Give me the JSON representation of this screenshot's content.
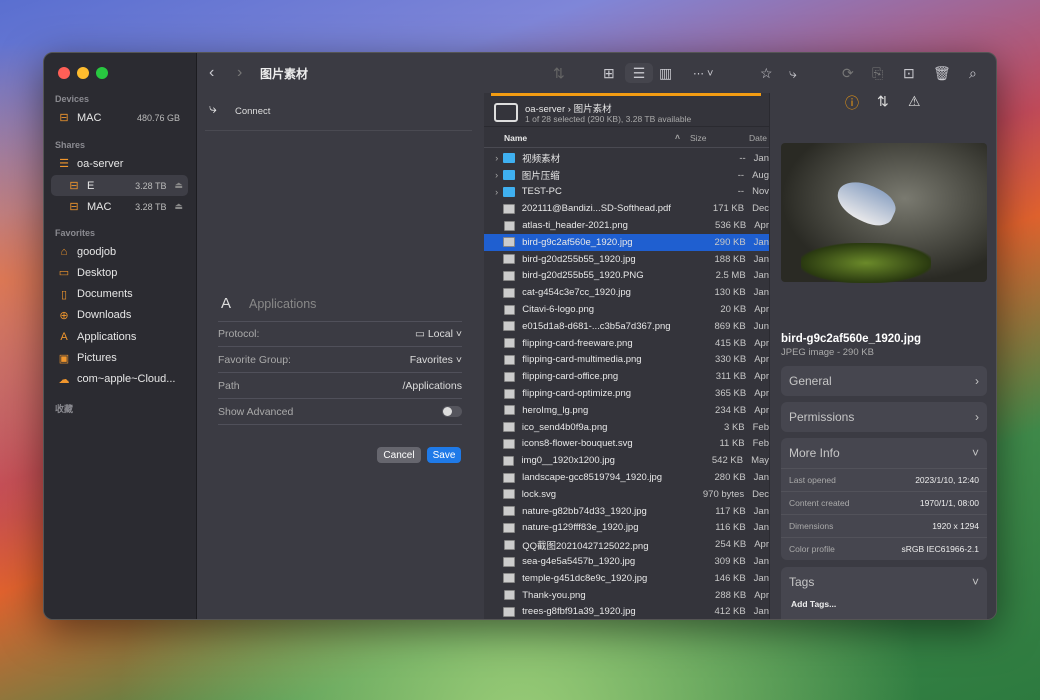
{
  "window": {
    "title": "图片素材"
  },
  "sidebar": {
    "sections": {
      "devices": "Devices",
      "shares": "Shares",
      "favorites": "Favorites",
      "collection": "收藏"
    },
    "devices": [
      {
        "label": "MAC",
        "size": "480.76 GB",
        "icon": "drive-icon"
      }
    ],
    "shares": [
      {
        "label": "oa-server",
        "icon": "server-icon"
      },
      {
        "label": "E",
        "size": "3.28 TB",
        "icon": "drive-icon",
        "eject": "⏏"
      },
      {
        "label": "MAC",
        "size": "3.28 TB",
        "icon": "drive-icon",
        "eject": "⏏"
      }
    ],
    "favorites": [
      {
        "label": "goodjob",
        "icon": "home-icon",
        "glyph": "⌂"
      },
      {
        "label": "Desktop",
        "icon": "desktop-icon",
        "glyph": "▭"
      },
      {
        "label": "Documents",
        "icon": "document-icon",
        "glyph": "▯"
      },
      {
        "label": "Downloads",
        "icon": "download-icon",
        "glyph": "⊕"
      },
      {
        "label": "Applications",
        "icon": "applications-icon",
        "glyph": "A"
      },
      {
        "label": "Pictures",
        "icon": "pictures-icon",
        "glyph": "▣"
      },
      {
        "label": "com~apple~Cloud...",
        "icon": "cloud-icon",
        "glyph": "☁"
      }
    ]
  },
  "connect": {
    "label": "Connect"
  },
  "form": {
    "title": "Applications",
    "protocol_label": "Protocol:",
    "protocol_value": "Local",
    "group_label": "Favorite Group:",
    "group_value": "Favorites",
    "path_label": "Path",
    "path_value": "/Applications",
    "advanced_label": "Show Advanced",
    "advanced_on": false,
    "cancel": "Cancel",
    "save": "Save"
  },
  "accent": "#f39c12",
  "selection_color": "#1f5fd0",
  "location": {
    "server": "oa-server",
    "folder": "图片素材",
    "status": "1 of 28 selected (290 KB), 3.28 TB available",
    "progress": 1.0
  },
  "columns": {
    "name": "Name",
    "size": "Size",
    "date": "Date"
  },
  "files": [
    {
      "name": "视频素材",
      "size": "--",
      "date": "Jan",
      "folder": true
    },
    {
      "name": "图片压缩",
      "size": "--",
      "date": "Aug",
      "folder": true
    },
    {
      "name": "TEST-PC",
      "size": "--",
      "date": "Nov",
      "folder": true
    },
    {
      "name": "202111@Bandizi...SD-Softhead.pdf",
      "size": "171 KB",
      "date": "Dec"
    },
    {
      "name": "atlas-ti_header-2021.png",
      "size": "536 KB",
      "date": "Apr"
    },
    {
      "name": "bird-g9c2af560e_1920.jpg",
      "size": "290 KB",
      "date": "Jan",
      "selected": true
    },
    {
      "name": "bird-g20d255b55_1920.jpg",
      "size": "188 KB",
      "date": "Jan"
    },
    {
      "name": "bird-g20d255b55_1920.PNG",
      "size": "2.5 MB",
      "date": "Jan"
    },
    {
      "name": "cat-g454c3e7cc_1920.jpg",
      "size": "130 KB",
      "date": "Jan"
    },
    {
      "name": "Citavi-6-logo.png",
      "size": "20 KB",
      "date": "Apr"
    },
    {
      "name": "e015d1a8-d681-...c3b5a7d367.png",
      "size": "869 KB",
      "date": "Jun"
    },
    {
      "name": "flipping-card-freeware.png",
      "size": "415 KB",
      "date": "Apr"
    },
    {
      "name": "flipping-card-multimedia.png",
      "size": "330 KB",
      "date": "Apr"
    },
    {
      "name": "flipping-card-office.png",
      "size": "311 KB",
      "date": "Apr"
    },
    {
      "name": "flipping-card-optimize.png",
      "size": "365 KB",
      "date": "Apr"
    },
    {
      "name": "heroImg_lg.png",
      "size": "234 KB",
      "date": "Apr"
    },
    {
      "name": "ico_send4b0f9a.png",
      "size": "3 KB",
      "date": "Feb"
    },
    {
      "name": "icons8-flower-bouquet.svg",
      "size": "11 KB",
      "date": "Feb"
    },
    {
      "name": "img0__1920x1200.jpg",
      "size": "542 KB",
      "date": "May"
    },
    {
      "name": "landscape-gcc8519794_1920.jpg",
      "size": "280 KB",
      "date": "Jan"
    },
    {
      "name": "lock.svg",
      "size": "970 bytes",
      "date": "Dec"
    },
    {
      "name": "nature-g82bb74d33_1920.jpg",
      "size": "117 KB",
      "date": "Jan"
    },
    {
      "name": "nature-g129fff83e_1920.jpg",
      "size": "116 KB",
      "date": "Jan"
    },
    {
      "name": "QQ截图20210427125022.png",
      "size": "254 KB",
      "date": "Apr"
    },
    {
      "name": "sea-g4e5a5457b_1920.jpg",
      "size": "309 KB",
      "date": "Jan"
    },
    {
      "name": "temple-g451dc8e9c_1920.jpg",
      "size": "146 KB",
      "date": "Jan"
    },
    {
      "name": "Thank-you.png",
      "size": "288 KB",
      "date": "Apr"
    },
    {
      "name": "trees-g8fbf91a39_1920.jpg",
      "size": "412 KB",
      "date": "Jan"
    }
  ],
  "info": {
    "filename": "bird-g9c2af560e_1920.jpg",
    "kind": "JPEG image - 290 KB",
    "general": "General",
    "permissions": "Permissions",
    "more_info": "More Info",
    "details": [
      {
        "k": "Last opened",
        "v": "2023/1/10, 12:40"
      },
      {
        "k": "Content created",
        "v": "1970/1/1, 08:00"
      },
      {
        "k": "Dimensions",
        "v": "1920 x 1294"
      },
      {
        "k": "Color profile",
        "v": "sRGB IEC61966-2.1"
      }
    ],
    "tags": "Tags",
    "add_tags": "Add Tags..."
  }
}
